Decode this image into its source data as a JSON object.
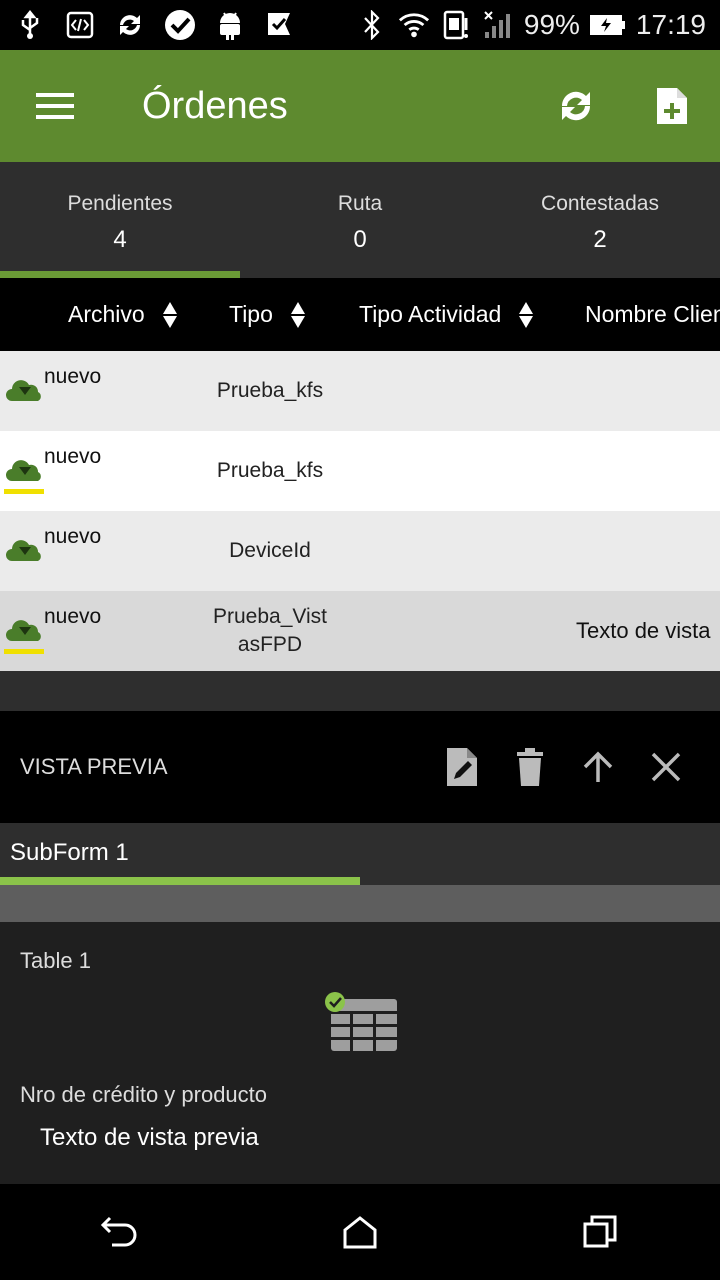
{
  "status_bar": {
    "battery": "99%",
    "time": "17:19",
    "icons": [
      "usb-icon",
      "code-icon",
      "sync-icon",
      "check-badge-icon",
      "android-icon",
      "check-flag-icon",
      "bluetooth-icon",
      "wifi-icon",
      "sim-icon",
      "signal-icon",
      "battery-icon"
    ]
  },
  "appbar": {
    "title": "Órdenes",
    "color": "#5e8a2f",
    "actions": [
      "refresh-icon",
      "new-document-icon"
    ]
  },
  "tabs": [
    {
      "label": "Pendientes",
      "count": "4"
    },
    {
      "label": "Ruta",
      "count": "0"
    },
    {
      "label": "Contestadas",
      "count": "2"
    }
  ],
  "table": {
    "columns": [
      "Archivo",
      "Tipo",
      "Tipo Actividad",
      "Nombre Clien"
    ],
    "rows": [
      {
        "archivo": "nuevo",
        "tipo": "Prueba_kfs",
        "tipo_actividad": "",
        "nombre": "",
        "flagged": false
      },
      {
        "archivo": "nuevo",
        "tipo": "Prueba_kfs",
        "tipo_actividad": "",
        "nombre": "",
        "flagged": true
      },
      {
        "archivo": "nuevo",
        "tipo": "DeviceId",
        "tipo_actividad": "",
        "nombre": "",
        "flagged": false
      },
      {
        "archivo": "nuevo",
        "tipo": "Prueba_VistasFPD",
        "tipo_actividad": "",
        "nombre": "Texto de vista",
        "flagged": true
      }
    ]
  },
  "preview": {
    "title": "VISTA PREVIA",
    "actions": [
      "edit-document-icon",
      "delete-icon",
      "arrow-up-icon",
      "close-icon"
    ]
  },
  "subform": {
    "tab_label": "SubForm 1",
    "indicator_color": "#8bc34a"
  },
  "form": {
    "table_label": "Table 1",
    "field_label": "Nro de crédito y producto",
    "field_value": "Texto de vista previa"
  },
  "navbar": [
    "back-icon",
    "home-icon",
    "recents-icon"
  ]
}
